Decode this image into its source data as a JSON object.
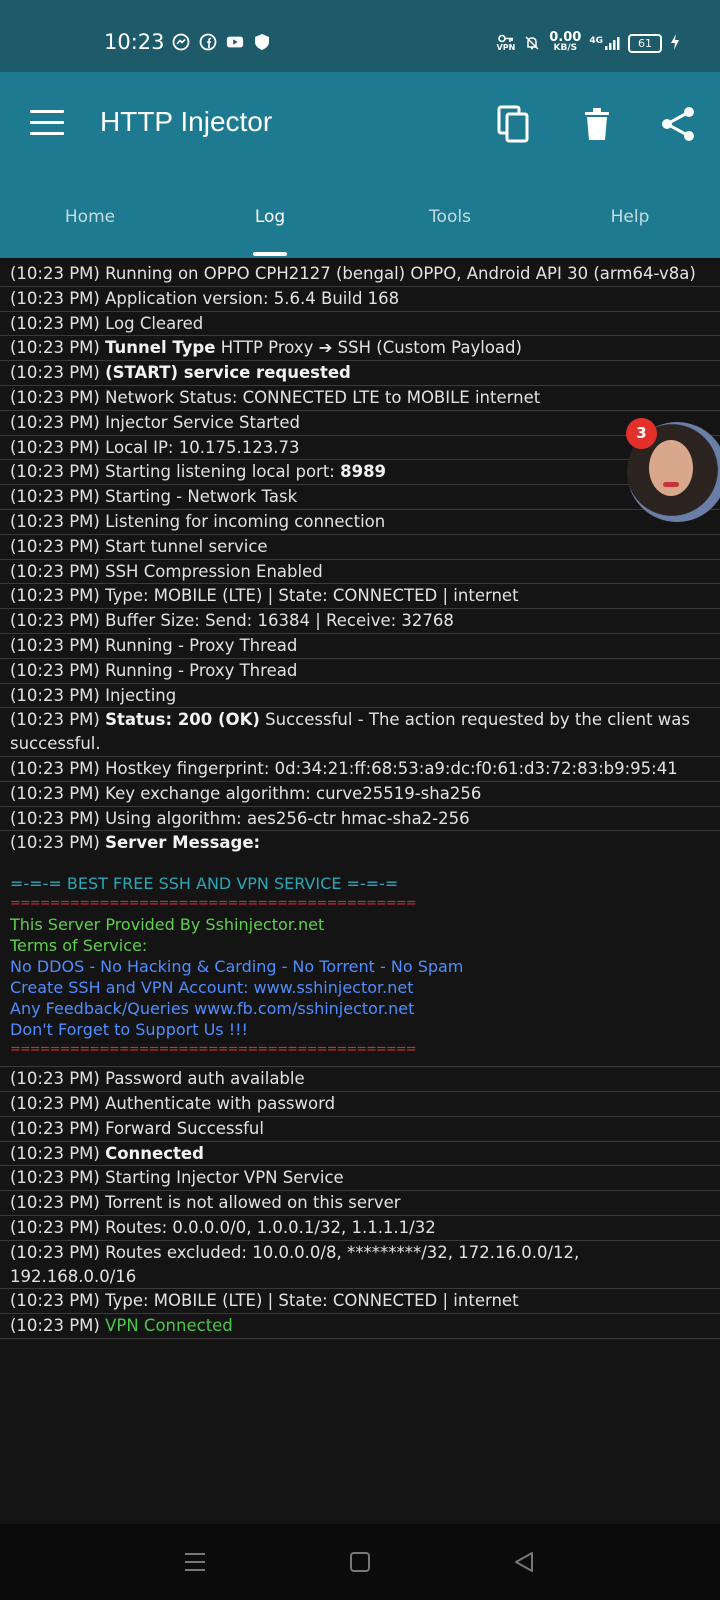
{
  "status_bar": {
    "time": "10:23",
    "left_icons": [
      "messenger-icon",
      "facebook-icon",
      "youtube-icon",
      "shield-icon"
    ],
    "vpn_label": "VPN",
    "speed_value": "0.00",
    "speed_unit": "KB/S",
    "network": "4G",
    "battery": "61"
  },
  "app_bar": {
    "title": "HTTP Injector",
    "actions": [
      "copy-icon",
      "delete-icon",
      "share-icon"
    ]
  },
  "tabs": [
    {
      "label": "Home"
    },
    {
      "label": "Log"
    },
    {
      "label": "Tools"
    },
    {
      "label": "Help"
    }
  ],
  "active_tab": "Log",
  "log": {
    "lines1": [
      {
        "ts": "(10:23 PM)",
        "bold": "",
        "text": "Running on OPPO CPH2127 (bengal) OPPO,  Android API 30 (arm64-v8a)"
      },
      {
        "ts": "(10:23 PM)",
        "bold": "",
        "text": "Application version: 5.6.4 Build 168"
      },
      {
        "ts": "(10:23 PM)",
        "bold": "",
        "text": "Log Cleared"
      },
      {
        "ts": "(10:23 PM)",
        "bold": "Tunnel Type",
        "text": "HTTP Proxy ➔ SSH (Custom Payload)"
      },
      {
        "ts": "(10:23 PM)",
        "bold": "(START) service requested",
        "text": ""
      },
      {
        "ts": "(10:23 PM)",
        "bold": "",
        "text": "Network Status: CONNECTED LTE to MOBILE internet"
      },
      {
        "ts": "(10:23 PM)",
        "bold": "",
        "text": "Injector Service Started"
      },
      {
        "ts": "(10:23 PM)",
        "bold": "",
        "text": "Local IP: 10.175.123.73"
      },
      {
        "ts": "(10:23 PM)",
        "bold": "",
        "text": "Starting listening local port:",
        "tail_bold": "8989"
      },
      {
        "ts": "(10:23 PM)",
        "bold": "",
        "text": "Starting - Network Task"
      },
      {
        "ts": "(10:23 PM)",
        "bold": "",
        "text": "Listening for incoming connection"
      },
      {
        "ts": "(10:23 PM)",
        "bold": "",
        "text": "Start tunnel service"
      },
      {
        "ts": "(10:23 PM)",
        "bold": "",
        "text": "SSH Compression Enabled"
      },
      {
        "ts": "(10:23 PM)",
        "bold": "",
        "text": "Type: MOBILE (LTE) | State: CONNECTED | internet"
      },
      {
        "ts": "(10:23 PM)",
        "bold": "",
        "text": "Buffer Size: Send: 16384 | Receive: 32768"
      },
      {
        "ts": "(10:23 PM)",
        "bold": "",
        "text": "Running - Proxy Thread"
      },
      {
        "ts": "(10:23 PM)",
        "bold": "",
        "text": "Running - Proxy Thread"
      },
      {
        "ts": "(10:23 PM)",
        "bold": "",
        "text": "Injecting"
      },
      {
        "ts": "(10:23 PM)",
        "bold": "Status: 200 (OK)",
        "text": "Successful - The action requested by the client was successful."
      },
      {
        "ts": "(10:23 PM)",
        "bold": "",
        "text": "Hostkey fingerprint: 0d:34:21:ff:68:53:a9:dc:f0:61:d3:72:83:b9:95:41"
      },
      {
        "ts": "(10:23 PM)",
        "bold": "",
        "text": "Key exchange algorithm: curve25519-sha256"
      },
      {
        "ts": "(10:23 PM)",
        "bold": "",
        "text": "Using algorithm: aes256-ctr hmac-sha2-256"
      }
    ],
    "server_message_label": "Server Message:",
    "server_ts": "(10:23 PM)",
    "server_block": {
      "banner": "=-=-= BEST FREE SSH AND VPN SERVICE =-=-=",
      "divider": "=========================================",
      "provided_by": "This Server Provided By Sshinjector.net",
      "terms": "Terms of Service:",
      "rules": "No DDOS - No Hacking & Carding - No Torrent - No Spam",
      "create": "Create SSH and VPN Account: www.sshinjector.net",
      "feedback": "Any Feedback/Queries www.fb.com/sshinjector.net",
      "support": "Don't Forget to Support Us !!!",
      "divider2": "========================================="
    },
    "lines2": [
      {
        "ts": "(10:23 PM)",
        "bold": "",
        "text": "Password auth available"
      },
      {
        "ts": "(10:23 PM)",
        "bold": "",
        "text": "Authenticate with password"
      },
      {
        "ts": "(10:23 PM)",
        "bold": "",
        "text": "Forward Successful"
      },
      {
        "ts": "(10:23 PM)",
        "bold": "Connected",
        "text": ""
      },
      {
        "ts": "(10:23 PM)",
        "bold": "",
        "text": "Starting Injector VPN Service"
      },
      {
        "ts": "(10:23 PM)",
        "bold": "",
        "text": "Torrent is not allowed on this server"
      },
      {
        "ts": "(10:23 PM)",
        "bold": "",
        "text": "Routes: 0.0.0.0/0,  1.0.0.1/32,  1.1.1.1/32"
      },
      {
        "ts": "(10:23 PM)",
        "bold": "",
        "text": "Routes excluded: 10.0.0.0/8,  *********/32,  172.16.0.0/12,  192.168.0.0/16"
      },
      {
        "ts": "(10:23 PM)",
        "bold": "",
        "text": "Type: MOBILE (LTE) | State: CONNECTED | internet"
      }
    ],
    "last_ts": "(10:23 PM)",
    "last_text": "VPN Connected"
  },
  "chat_head": {
    "badge_count": "3"
  },
  "colors": {
    "status_bar": "#1d5a6a",
    "app_bar": "#1e7a91",
    "background": "#141414",
    "banner_teal": "#2aa6b8",
    "divider_red": "#e5242a",
    "server_green": "#5fd04c",
    "server_blue": "#4f8dff"
  },
  "nav_bar": [
    "recents-icon",
    "home-icon",
    "back-icon"
  ]
}
